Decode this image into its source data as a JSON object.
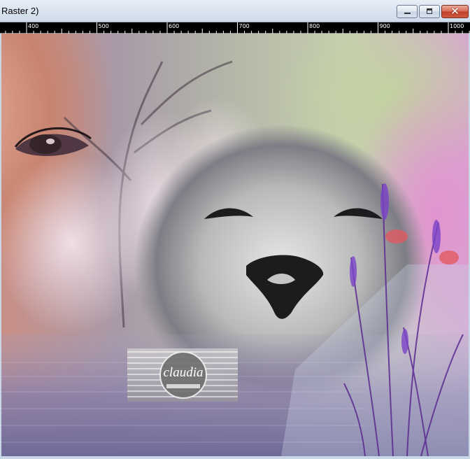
{
  "window": {
    "title": "Raster 2)",
    "buttons": {
      "minimize": "minimize-icon",
      "maximize": "maximize-icon",
      "close": "close-icon"
    }
  },
  "ruler": {
    "labels": [
      "400",
      "500",
      "600",
      "700",
      "800",
      "900",
      "1000"
    ]
  },
  "canvas": {
    "watermark": {
      "text": "claudia"
    }
  },
  "colors": {
    "ruler_bg": "#000000",
    "titlebar": "#dfe7f1",
    "close_button": "#c2402a"
  }
}
